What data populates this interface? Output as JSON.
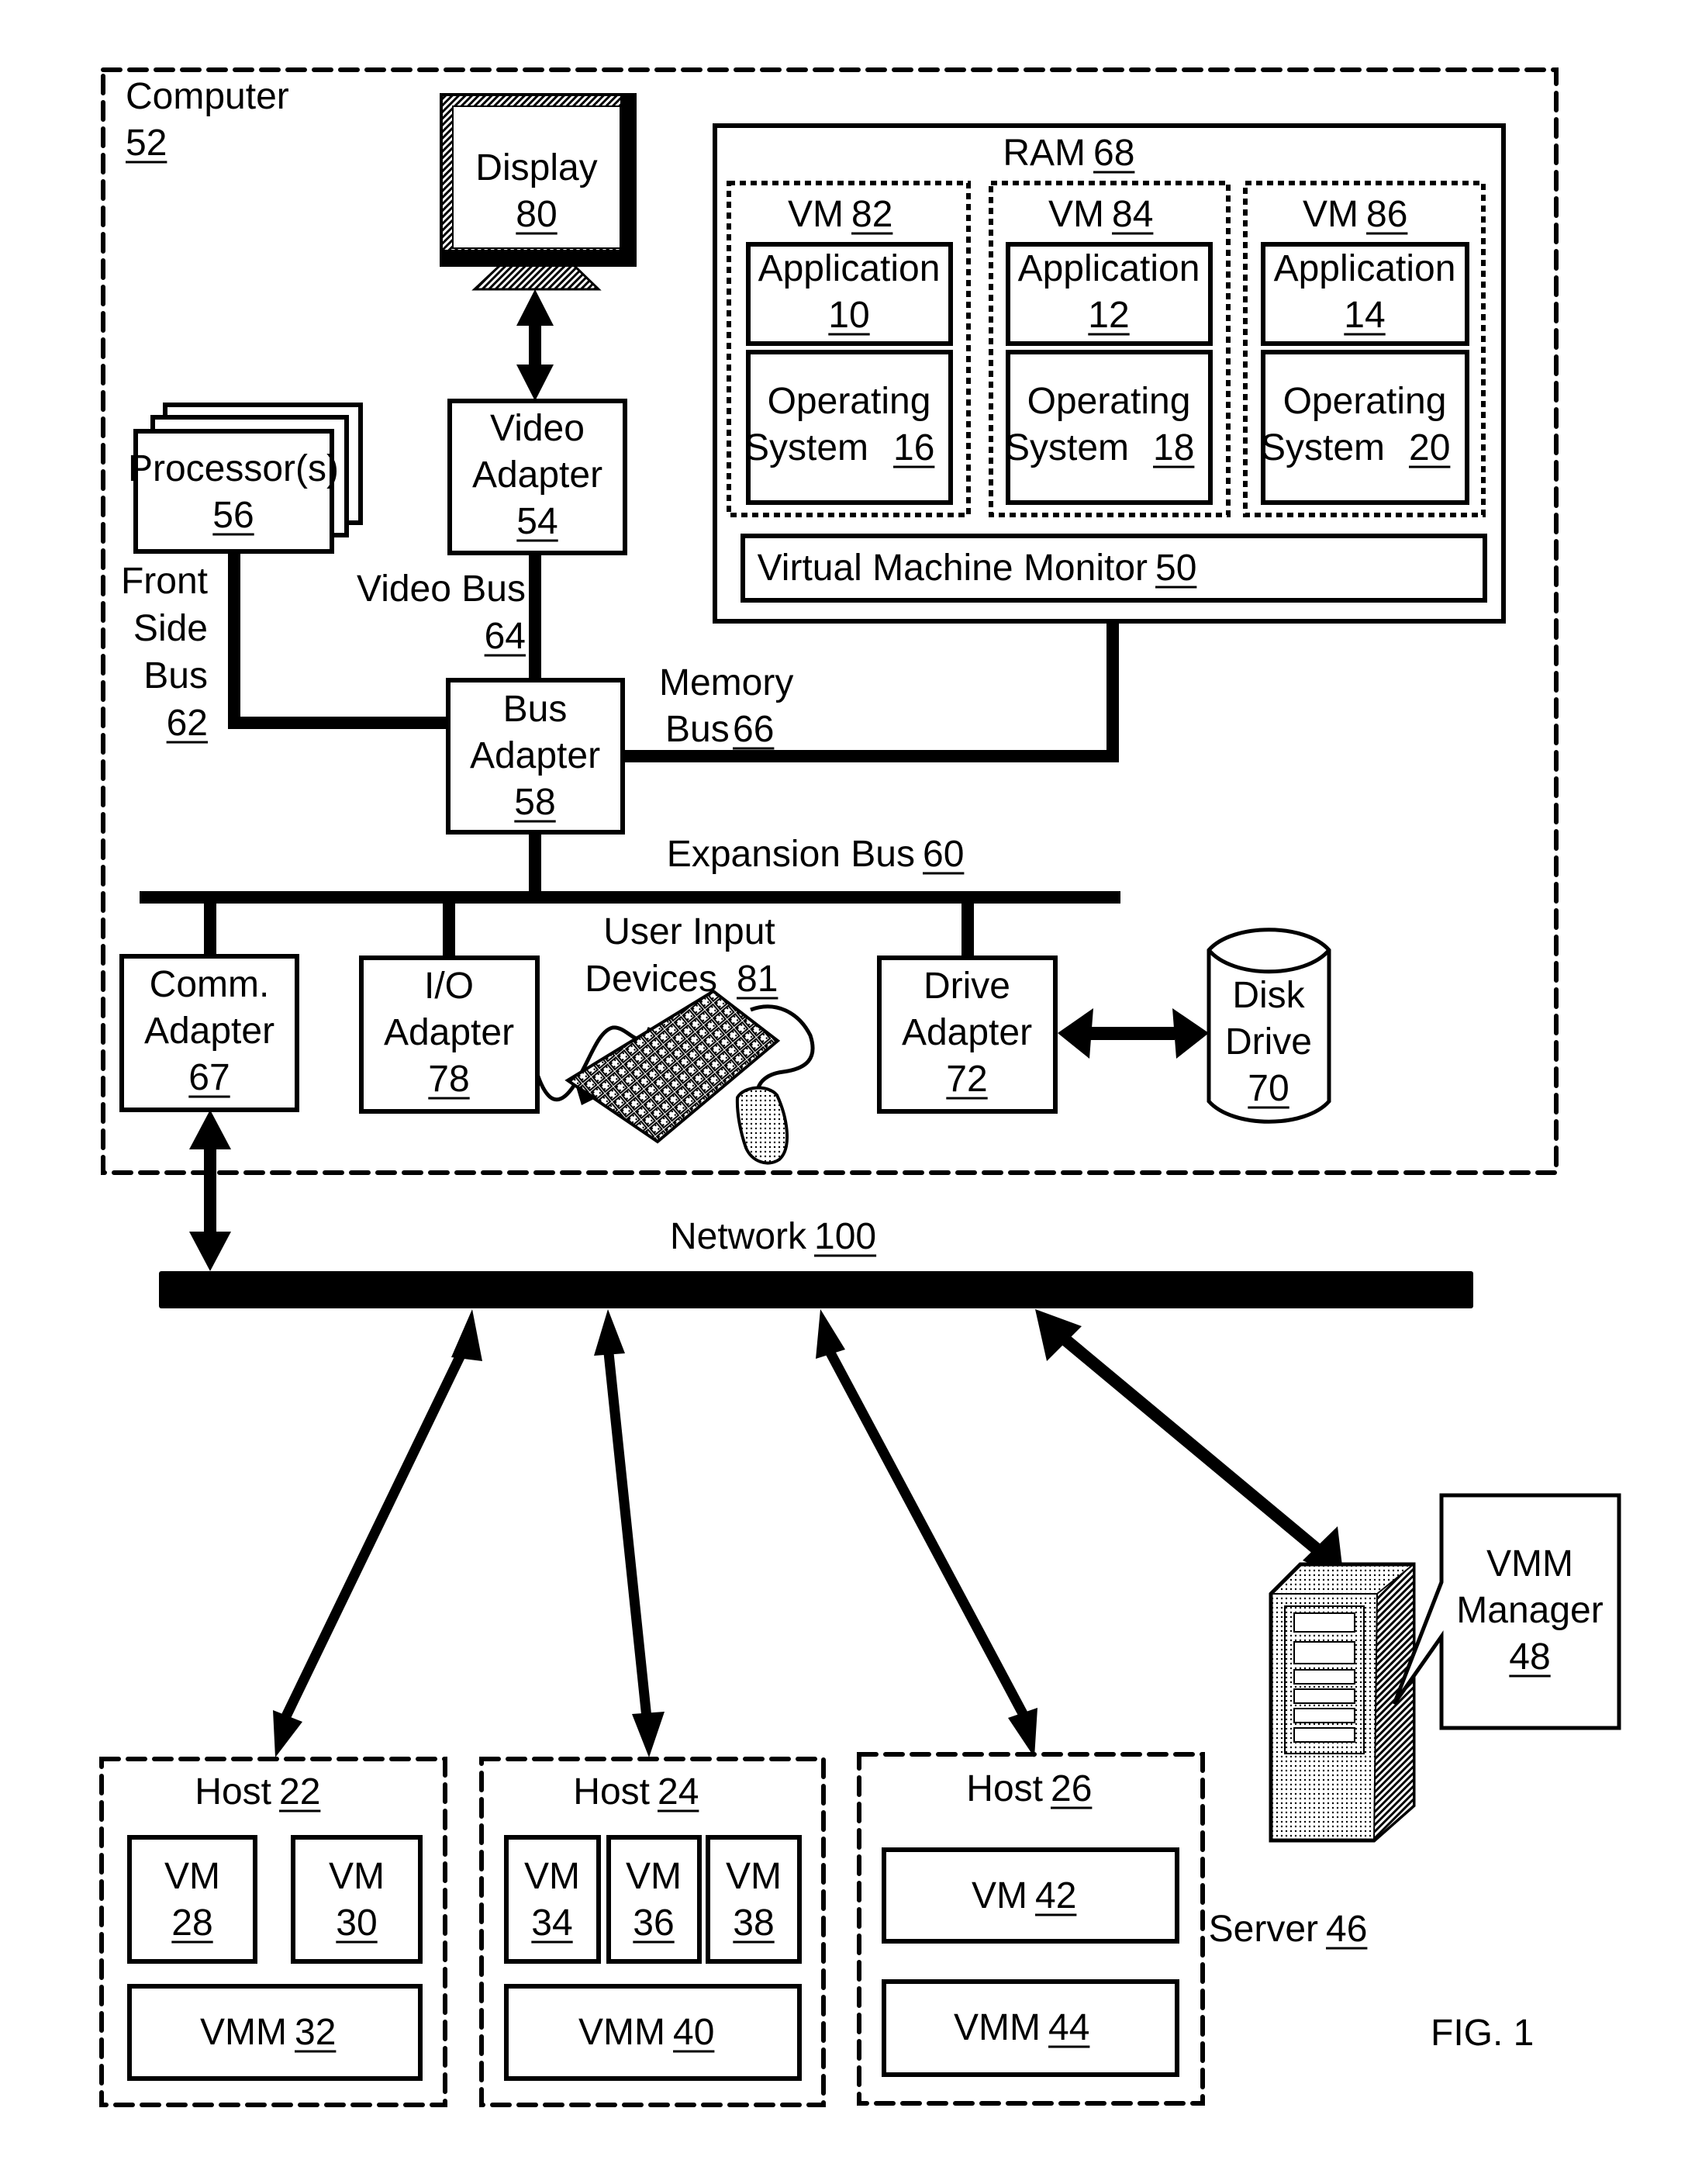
{
  "figure": {
    "label": "FIG. 1",
    "colors": {
      "ink": "#000000",
      "paper": "#ffffff"
    }
  },
  "computer": {
    "label": "Computer",
    "ref": "52",
    "display": {
      "label": "Display",
      "ref": "80"
    },
    "video_adapter": {
      "line1": "Video",
      "line2": "Adapter",
      "ref": "54"
    },
    "processors": {
      "label": "Processor(s)",
      "ref": "56"
    },
    "front_side_bus": {
      "line1": "Front",
      "line2": "Side",
      "line3": "Bus",
      "ref": "62"
    },
    "video_bus": {
      "label": "Video Bus",
      "ref": "64"
    },
    "bus_adapter": {
      "line1": "Bus",
      "line2": "Adapter",
      "ref": "58"
    },
    "memory_bus": {
      "line1": "Memory",
      "line2": "Bus",
      "ref": "66"
    },
    "expansion_bus": {
      "label": "Expansion Bus",
      "ref": "60"
    },
    "comm_adapter": {
      "line1": "Comm.",
      "line2": "Adapter",
      "ref": "67"
    },
    "io_adapter": {
      "line1": "I/O",
      "line2": "Adapter",
      "ref": "78"
    },
    "user_input": {
      "line1": "User Input",
      "line2": "Devices",
      "ref": "81"
    },
    "drive_adapter": {
      "line1": "Drive",
      "line2": "Adapter",
      "ref": "72"
    },
    "disk_drive": {
      "line1": "Disk",
      "line2": "Drive",
      "ref": "70"
    },
    "ram": {
      "label": "RAM",
      "ref": "68",
      "vms": [
        {
          "label": "VM",
          "ref": "82",
          "app_label": "Application",
          "app_ref": "10",
          "os_line1": "Operating",
          "os_line2": "System",
          "os_ref": "16"
        },
        {
          "label": "VM",
          "ref": "84",
          "app_label": "Application",
          "app_ref": "12",
          "os_line1": "Operating",
          "os_line2": "System",
          "os_ref": "18"
        },
        {
          "label": "VM",
          "ref": "86",
          "app_label": "Application",
          "app_ref": "14",
          "os_line1": "Operating",
          "os_line2": "System",
          "os_ref": "20"
        }
      ],
      "vmm": {
        "label": "Virtual Machine Monitor",
        "ref": "50"
      }
    }
  },
  "network": {
    "label": "Network",
    "ref": "100"
  },
  "hosts": [
    {
      "label": "Host",
      "ref": "22",
      "vms": [
        {
          "label": "VM",
          "ref": "28"
        },
        {
          "label": "VM",
          "ref": "30"
        }
      ],
      "vmm": {
        "label": "VMM",
        "ref": "32"
      }
    },
    {
      "label": "Host",
      "ref": "24",
      "vms": [
        {
          "label": "VM",
          "ref": "34"
        },
        {
          "label": "VM",
          "ref": "36"
        },
        {
          "label": "VM",
          "ref": "38"
        }
      ],
      "vmm": {
        "label": "VMM",
        "ref": "40"
      }
    },
    {
      "label": "Host",
      "ref": "26",
      "vms": [
        {
          "label": "VM",
          "ref": "42"
        }
      ],
      "vmm": {
        "label": "VMM",
        "ref": "44"
      }
    }
  ],
  "server": {
    "label": "Server",
    "ref": "46"
  },
  "vmm_manager": {
    "line1": "VMM",
    "line2": "Manager",
    "ref": "48"
  }
}
